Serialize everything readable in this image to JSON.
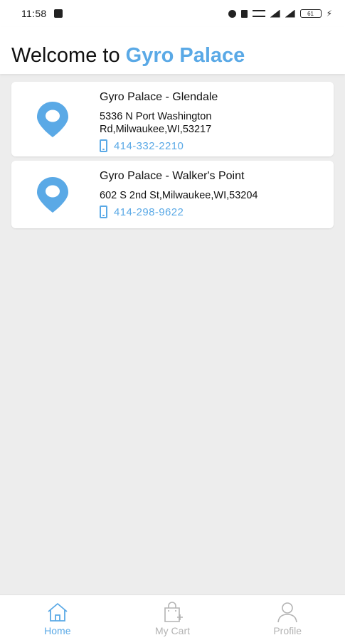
{
  "status_bar": {
    "time": "11:58",
    "battery": "61"
  },
  "header": {
    "welcome": "Welcome to",
    "brand": "Gyro Palace"
  },
  "stores": [
    {
      "name": "Gyro Palace - Glendale",
      "address_line1": "5336 N Port Washington",
      "address_line2": "Rd,Milwaukee,WI,53217",
      "phone": "414-332-2210"
    },
    {
      "name": "Gyro Palace - Walker's Point",
      "address_line1": "602 S 2nd St,Milwaukee,WI,53204",
      "phone": "414-298-9622"
    }
  ],
  "bottom_nav": {
    "home": "Home",
    "cart": "My Cart",
    "profile": "Profile"
  },
  "colors": {
    "accent": "#5aa9e6",
    "background": "#ededed",
    "inactive": "#b3b3b3"
  }
}
